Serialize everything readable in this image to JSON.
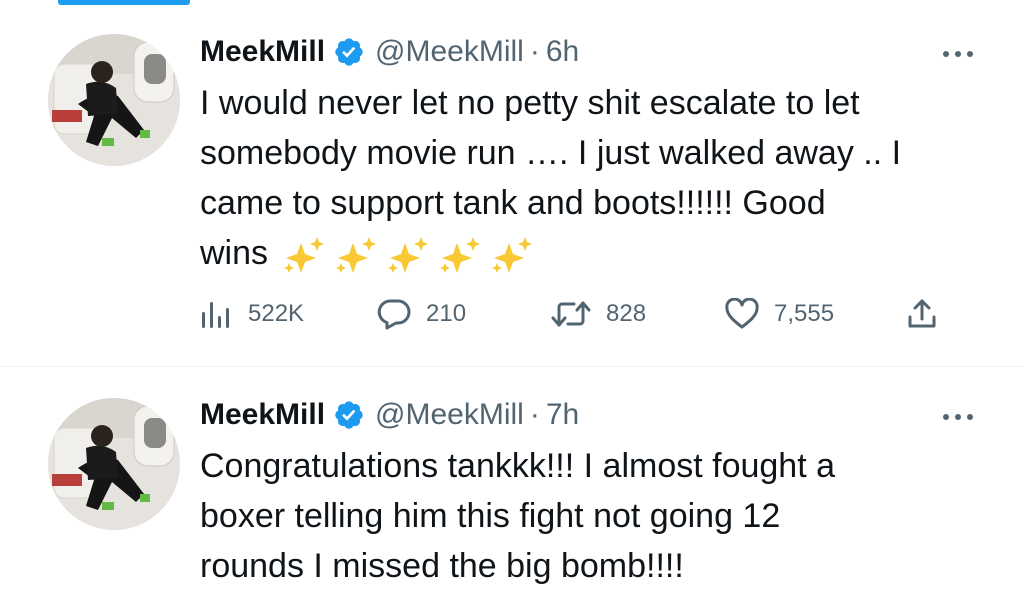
{
  "tweets": [
    {
      "author": "MeekMill",
      "handle": "@MeekMill",
      "separator": "·",
      "time": "6h",
      "text_lines": [
        "I would never let no petty shit escalate to let",
        "somebody movie run …. I just walked away .. I",
        "came to support tank and boots!!!!!! Good",
        "wins"
      ],
      "emoji": [
        "sparkles-icon",
        "sparkles-icon",
        "sparkles-icon",
        "sparkles-icon",
        "sparkles-icon"
      ],
      "stats": {
        "views": "522K",
        "replies": "210",
        "retweets": "828",
        "likes": "7,555"
      }
    },
    {
      "author": "MeekMill",
      "handle": "@MeekMill",
      "separator": "·",
      "time": "7h",
      "text_lines": [
        "Congratulations tankkk!!! I almost fought a",
        "boxer telling him this fight not going 12",
        "rounds I missed the big bomb!!!!"
      ]
    }
  ],
  "colors": {
    "accent": "#1d9bf0",
    "text": "#0f1419",
    "secondary": "#536471",
    "sparkle": "#f8c933"
  }
}
